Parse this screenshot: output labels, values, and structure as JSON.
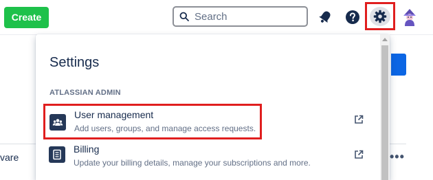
{
  "topbar": {
    "create_label": "Create",
    "search_placeholder": "Search",
    "search_value": "",
    "icons": [
      "search-icon",
      "bell-icon",
      "help-icon",
      "gear-icon",
      "avatar"
    ]
  },
  "background": {
    "row_text": "vare",
    "more_glyph": "•••"
  },
  "settings_panel": {
    "title": "Settings",
    "section": "ATLASSIAN ADMIN",
    "items": [
      {
        "label": "User management",
        "description": "Add users, groups, and manage access requests.",
        "icon": "people-icon",
        "external_icon": "external-link-icon"
      },
      {
        "label": "Billing",
        "description": "Update your billing details, manage your subscriptions and more.",
        "icon": "document-icon",
        "external_icon": "external-link-icon"
      }
    ]
  },
  "colors": {
    "create": "#1ec14a",
    "highlight": "#e01e1e",
    "accent_blue": "#0c66e4",
    "icon_tile": "#253858"
  }
}
